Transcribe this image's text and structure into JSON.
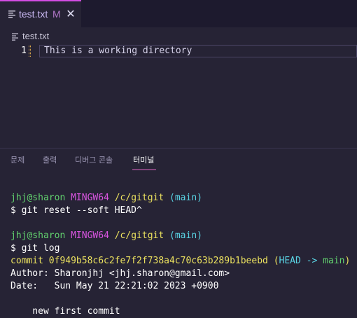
{
  "editor_tab": {
    "label": "test.txt",
    "status": "M",
    "close_glyph": "✕"
  },
  "breadcrumb": {
    "label": "test.txt"
  },
  "editor": {
    "line_number": "1",
    "line_text": "This is a working directory"
  },
  "panel": {
    "tabs": [
      "문제",
      "출력",
      "디버그 콘솔",
      "터미널"
    ],
    "active_tab": "터미널"
  },
  "terminal": {
    "prompt1": {
      "user": "jhj@sharon",
      "system": "MINGW64",
      "path": "/c/gitgit",
      "branch": "(main)"
    },
    "cmd1": "$ git reset --soft HEAD^",
    "prompt2": {
      "user": "jhj@sharon",
      "system": "MINGW64",
      "path": "/c/gitgit",
      "branch": "(main)"
    },
    "cmd2": "$ git log",
    "commit_line": {
      "label": "commit 0f949b58c6c2fe7f2f738a4c70c63b289b1beebd",
      "ref_open": "(",
      "head": "HEAD",
      "arrow": "->",
      "branch": "main",
      "ref_close": ")"
    },
    "author": "Author: Sharonjhj <jhj.sharon@gmail.com>",
    "date": "Date:   Sun May 21 22:21:02 2023 +0900",
    "message": "    new first commit"
  },
  "colors": {
    "background": "#262335",
    "accent": "#d24ce2",
    "green": "#62d16e",
    "magenta": "#d955e0",
    "yellow": "#ece25f",
    "cyan": "#5ad6e6"
  },
  "icons": {
    "file": "file-lines-icon",
    "close": "close-icon"
  }
}
